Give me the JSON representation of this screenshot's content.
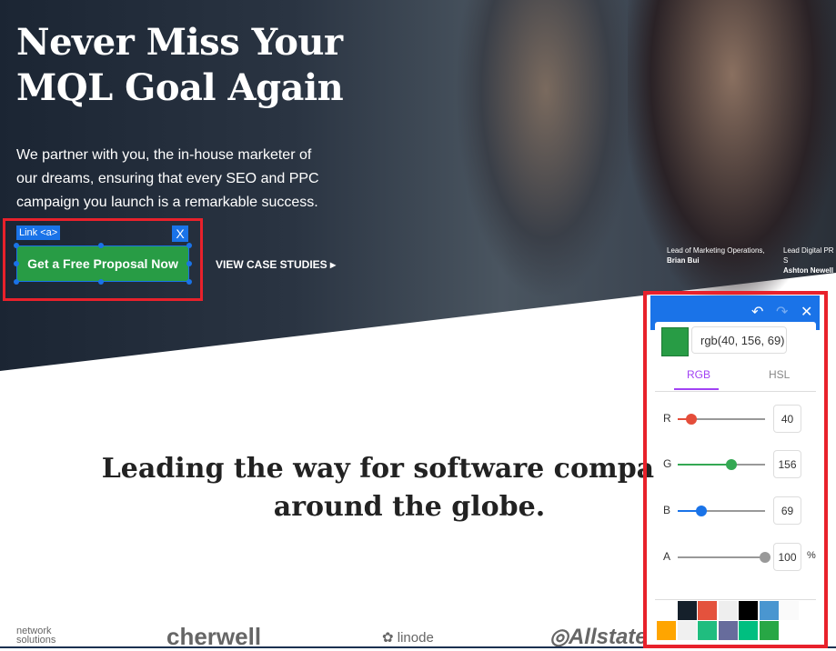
{
  "hero": {
    "title": "Never Miss Your MQL Goal Again",
    "subtitle": "We partner with you, the in-house marketer of our dreams, ensuring that every SEO and PPC campaign you launch is a remarkable success.",
    "cta": "Get a Free Proposal Now",
    "case_studies": "VIEW CASE STUDIES",
    "people": [
      {
        "role": "Lead of Marketing Operations,",
        "name": "Brian Bui"
      },
      {
        "role": "Lead Digital PR S",
        "name": "Ashton Newell"
      }
    ]
  },
  "inspector": {
    "tag": "Link <a>",
    "close": "X"
  },
  "section": {
    "heading": "Leading the way for software companies around the globe."
  },
  "logos": [
    "network solutions",
    "cherwell",
    "linode",
    "Allstate"
  ],
  "picker": {
    "value": "rgb(40, 156, 69)",
    "color": "#289c45",
    "tabs": [
      "RGB",
      "HSL"
    ],
    "active_tab": "RGB",
    "channels": [
      {
        "label": "R",
        "value": "40",
        "max": 255,
        "color": "#e44d3a"
      },
      {
        "label": "G",
        "value": "156",
        "max": 255,
        "color": "#34a853"
      },
      {
        "label": "B",
        "value": "69",
        "max": 255,
        "color": "#1a73e8"
      },
      {
        "label": "A",
        "value": "100",
        "max": 100,
        "unit": "%",
        "color": "#999999"
      }
    ],
    "palette": [
      "#ffffff",
      "#15202b",
      "#e4523d",
      "#eeeeee",
      "#000000",
      "#4a96d0",
      "#fafafa",
      "#ffa500",
      "#f0f0f0",
      "#20bd7f",
      "#676c9c",
      "#00bf80",
      "#28a745"
    ]
  }
}
